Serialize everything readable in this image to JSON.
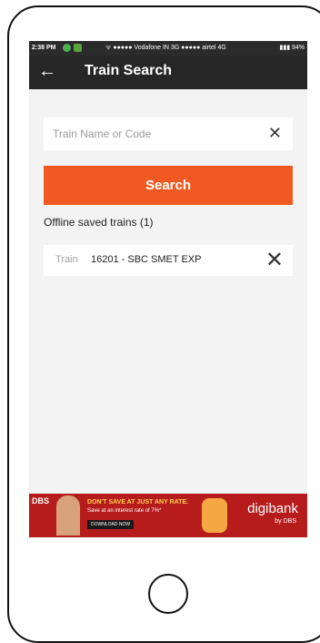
{
  "status": {
    "time": "2:38 PM",
    "carrier_text": "ᯤ ●●●●● Vodafone IN 3G ●●●●● airtel 4G",
    "battery_text": "▮▮▮ 94%"
  },
  "header": {
    "back_icon": "←",
    "title": "Train Search"
  },
  "search": {
    "placeholder": "Train Name or Code",
    "clear_icon": "✕",
    "button_label": "Search"
  },
  "offline": {
    "heading": "Offline saved trains (1)",
    "items": [
      {
        "label": "Train",
        "value": "16201 - SBC SMET EXP",
        "remove_icon": "✕"
      }
    ]
  },
  "ad": {
    "bank_logo": "DBS",
    "headline": "DON'T SAVE AT JUST ANY RATE.",
    "sub": "Save at an interest rate of 7%*",
    "cta": "DOWNLOAD NOW",
    "brand": "digibank",
    "by": "by DBS"
  },
  "colors": {
    "accent": "#f05a22",
    "appbar": "#262626",
    "ad_bg": "#b71c1c"
  }
}
